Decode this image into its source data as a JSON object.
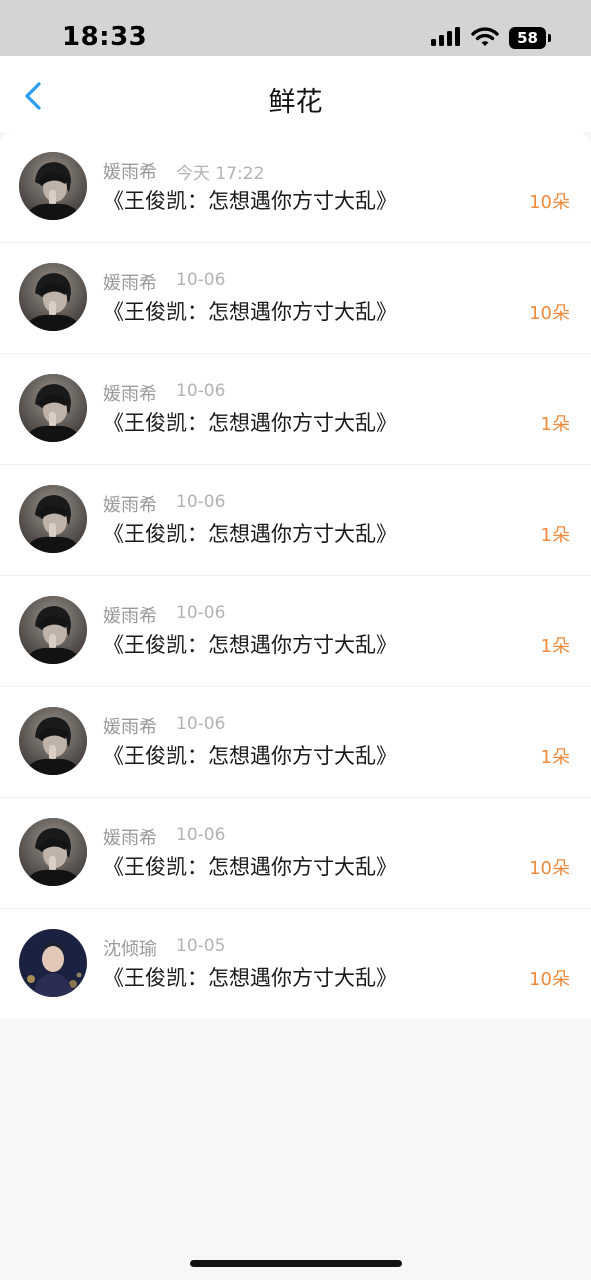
{
  "status_bar": {
    "time": "18:33",
    "battery": "58"
  },
  "nav": {
    "title": "鲜花",
    "back_icon": "chevron-left-icon",
    "accent_color": "#2b9ef2"
  },
  "colors": {
    "count": "#f08a3c",
    "name": "#9a9a9a",
    "date": "#b3b3b3"
  },
  "items": [
    {
      "sender": "媛雨希",
      "date": "今天 17:22",
      "book": "《王俊凯：怎想遇你方寸大乱》",
      "count": "10朵",
      "avatar": "dark-portrait"
    },
    {
      "sender": "媛雨希",
      "date": "10-06",
      "book": "《王俊凯：怎想遇你方寸大乱》",
      "count": "10朵",
      "avatar": "dark-portrait"
    },
    {
      "sender": "媛雨希",
      "date": "10-06",
      "book": "《王俊凯：怎想遇你方寸大乱》",
      "count": "1朵",
      "avatar": "dark-portrait"
    },
    {
      "sender": "媛雨希",
      "date": "10-06",
      "book": "《王俊凯：怎想遇你方寸大乱》",
      "count": "1朵",
      "avatar": "dark-portrait"
    },
    {
      "sender": "媛雨希",
      "date": "10-06",
      "book": "《王俊凯：怎想遇你方寸大乱》",
      "count": "1朵",
      "avatar": "dark-portrait"
    },
    {
      "sender": "媛雨希",
      "date": "10-06",
      "book": "《王俊凯：怎想遇你方寸大乱》",
      "count": "1朵",
      "avatar": "dark-portrait"
    },
    {
      "sender": "媛雨希",
      "date": "10-06",
      "book": "《王俊凯：怎想遇你方寸大乱》",
      "count": "10朵",
      "avatar": "dark-portrait"
    },
    {
      "sender": "沈倾瑜",
      "date": "10-05",
      "book": "《王俊凯：怎想遇你方寸大乱》",
      "count": "10朵",
      "avatar": "stage-portrait"
    }
  ]
}
